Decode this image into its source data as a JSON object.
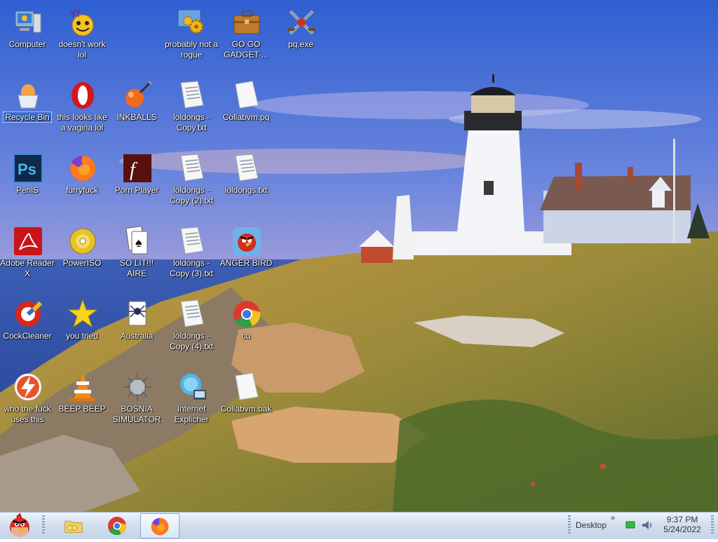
{
  "desktop": {
    "icons": [
      {
        "label": "Computer",
        "icon": "computer-icon"
      },
      {
        "label": "doesn't work lol",
        "icon": "yahoo-messenger-icon"
      },
      {
        "label": "probably not a rogue",
        "icon": "settings-gears-icon"
      },
      {
        "label": "GO GO GADGET ...",
        "icon": "briefcase-icon"
      },
      {
        "label": "pq.exe",
        "icon": "crossed-swords-icon"
      },
      {
        "label": "Recycle Bin",
        "icon": "recycle-bin-icon",
        "selected": true
      },
      {
        "label": "this looks like a vagina lol",
        "icon": "opera-icon"
      },
      {
        "label": "INKBALLS",
        "icon": "inkball-icon"
      },
      {
        "label": "loldongs - Copy.txt",
        "icon": "text-file-icon"
      },
      {
        "label": "Collabvm.pq",
        "icon": "blank-file-icon"
      },
      {
        "label": "PeniS",
        "icon": "photoshop-icon"
      },
      {
        "label": "furryfuck",
        "icon": "firefox-icon"
      },
      {
        "label": "Porn Player",
        "icon": "flash-icon"
      },
      {
        "label": "loldongs - Copy (2).txt",
        "icon": "text-file-icon"
      },
      {
        "label": "loldongs.txt",
        "icon": "text-file-icon"
      },
      {
        "label": "Adobe Reader X",
        "icon": "adobe-reader-icon"
      },
      {
        "label": "PowerISO",
        "icon": "disc-icon"
      },
      {
        "label": "SO LIT!!! AIRE",
        "icon": "solitaire-icon"
      },
      {
        "label": "loldongs - Copy (3).txt",
        "icon": "text-file-icon"
      },
      {
        "label": "ANGER BIRD",
        "icon": "angry-bird-icon"
      },
      {
        "label": "CockCleaner",
        "icon": "ccleaner-icon"
      },
      {
        "label": "you tried",
        "icon": "star-icon"
      },
      {
        "label": "Australia",
        "icon": "spider-solitaire-icon"
      },
      {
        "label": "loldongs - Copy (4).txt",
        "icon": "text-file-icon"
      },
      {
        "label": "cu",
        "icon": "chrome-icon"
      },
      {
        "label": "who the fuck uses this",
        "icon": "flash-lightning-icon"
      },
      {
        "label": "BEEP BEEP",
        "icon": "vlc-cone-icon"
      },
      {
        "label": "BOSNIA SIMULATOR",
        "icon": "spiked-mine-icon"
      },
      {
        "label": "Internet Explicher",
        "icon": "internet-explorer-icon"
      },
      {
        "label": "Collabvm.bak",
        "icon": "blank-file-icon"
      }
    ]
  },
  "taskbar": {
    "start": {
      "icon": "angry-bird-icon"
    },
    "pinned": [
      {
        "name": "file-explorer",
        "icon": "folder-icon"
      },
      {
        "name": "chrome",
        "icon": "chrome-icon"
      },
      {
        "name": "firefox",
        "icon": "firefox-icon",
        "active": true
      }
    ],
    "toolbar_label": "Desktop",
    "chevron": "»",
    "clock": {
      "time": "9:37 PM",
      "date": "5/24/2022"
    }
  }
}
